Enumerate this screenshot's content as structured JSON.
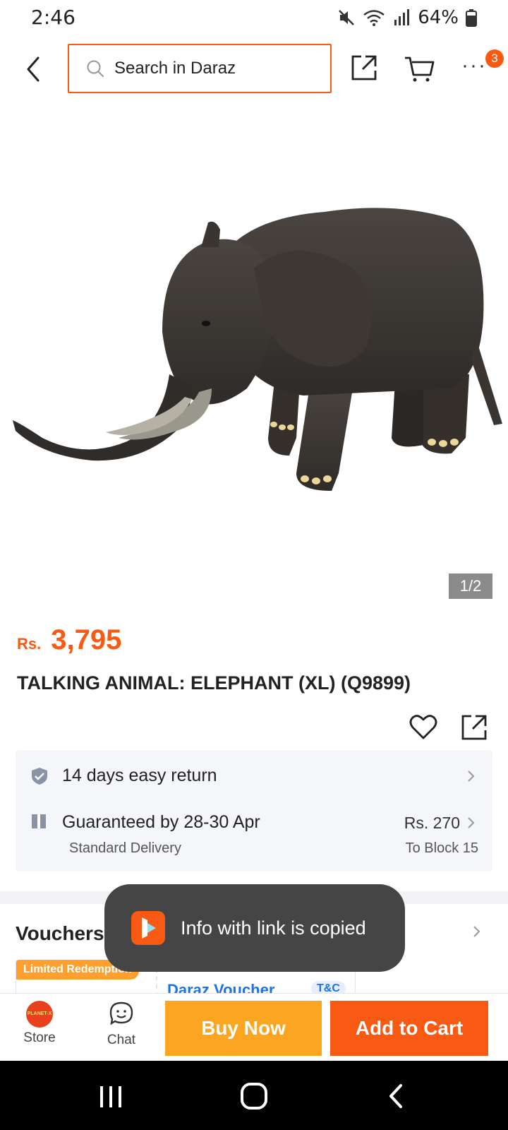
{
  "status_bar": {
    "time": "2:46",
    "battery": "64%"
  },
  "header": {
    "search_placeholder": "Search in Daraz",
    "cart_badge": "3"
  },
  "gallery": {
    "counter": "1/2"
  },
  "product": {
    "currency": "Rs.",
    "price": "3,795",
    "title": "TALKING ANIMAL: ELEPHANT (XL) (Q9899)"
  },
  "service": {
    "return_text": "14 days easy return",
    "delivery_text": "Guaranteed by 28-30 Apr",
    "delivery_type": "Standard Delivery",
    "delivery_fee": "Rs. 270",
    "delivery_location": "To Block 15"
  },
  "vouchers": {
    "title": "Vouchers",
    "badge": "Limited Redemption",
    "voucher_name": "Daraz Voucher",
    "terms": "T&C"
  },
  "toast": {
    "message": "Info with link is copied"
  },
  "action_bar": {
    "store_label": "Store",
    "store_logo_text": "PLANET-X",
    "chat_label": "Chat",
    "buy_now": "Buy Now",
    "add_to_cart": "Add to Cart"
  },
  "colors": {
    "brand_orange": "#f85a14",
    "buy_now_yellow": "#fca520",
    "voucher_blue": "#1a73e8"
  },
  "icons": {
    "status": [
      "mute-icon",
      "wifi-icon",
      "signal-icon",
      "battery-icon"
    ],
    "header": [
      "back-arrow-icon",
      "search-icon",
      "share-icon",
      "cart-icon",
      "more-icon"
    ]
  }
}
